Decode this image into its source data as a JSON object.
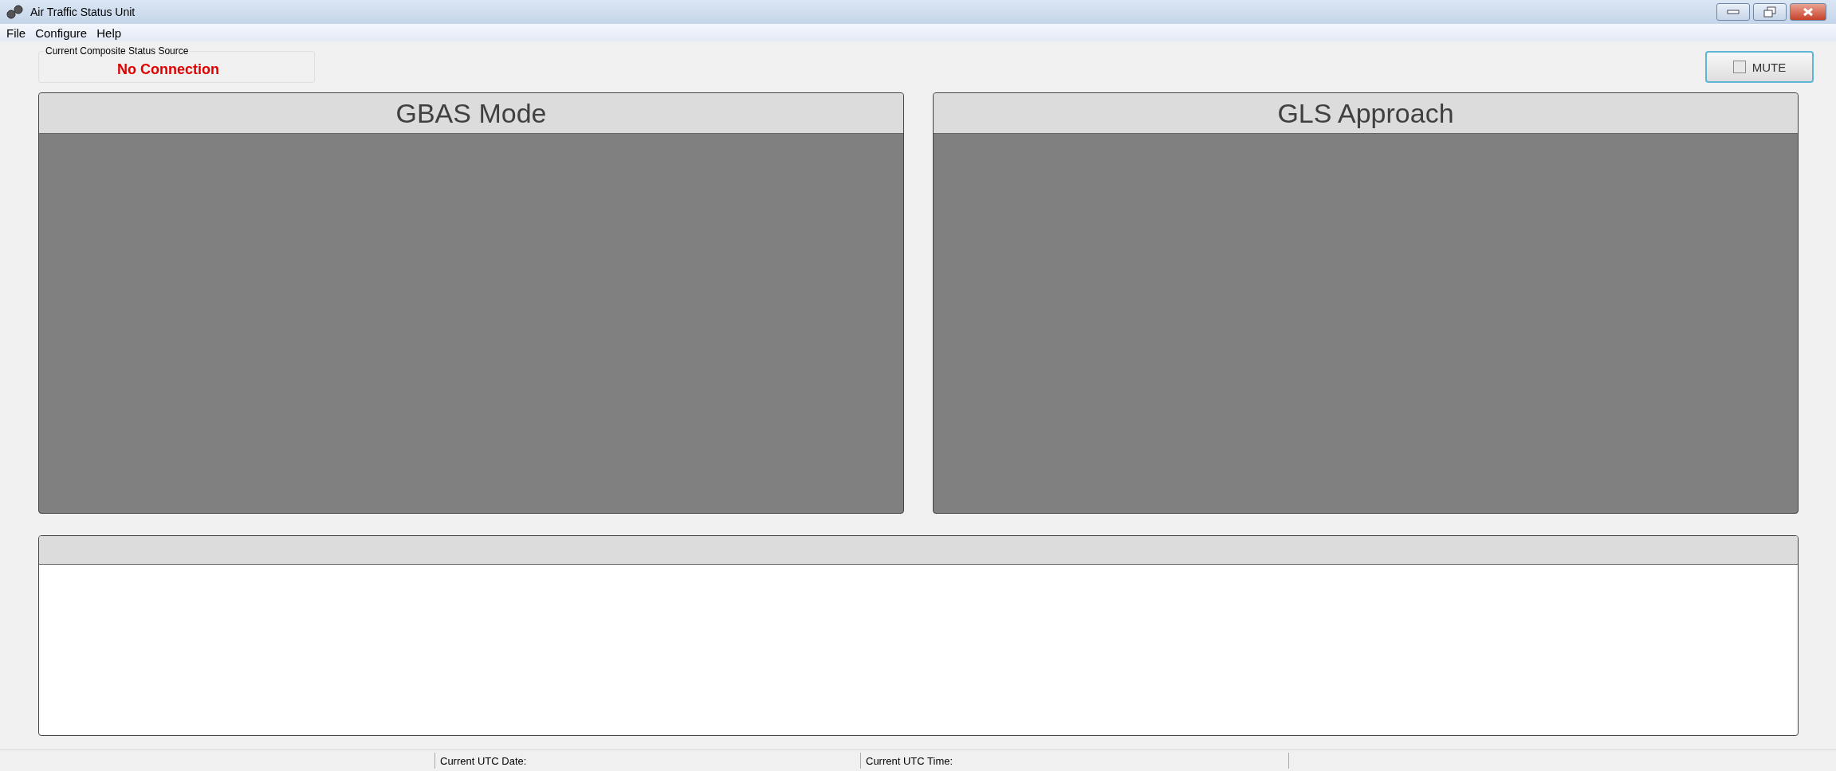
{
  "window": {
    "title": "Air Traffic Status Unit"
  },
  "menu": [
    "File",
    "Configure",
    "Help"
  ],
  "status_source": {
    "label": "Current Composite Status Source",
    "value": "No Connection"
  },
  "mute": {
    "label": "MUTE",
    "checked": false
  },
  "panels": [
    {
      "title": "GBAS Mode"
    },
    {
      "title": "GLS Approach"
    }
  ],
  "status_bar": [
    "Current UTC Date:",
    "Current UTC Time:"
  ]
}
